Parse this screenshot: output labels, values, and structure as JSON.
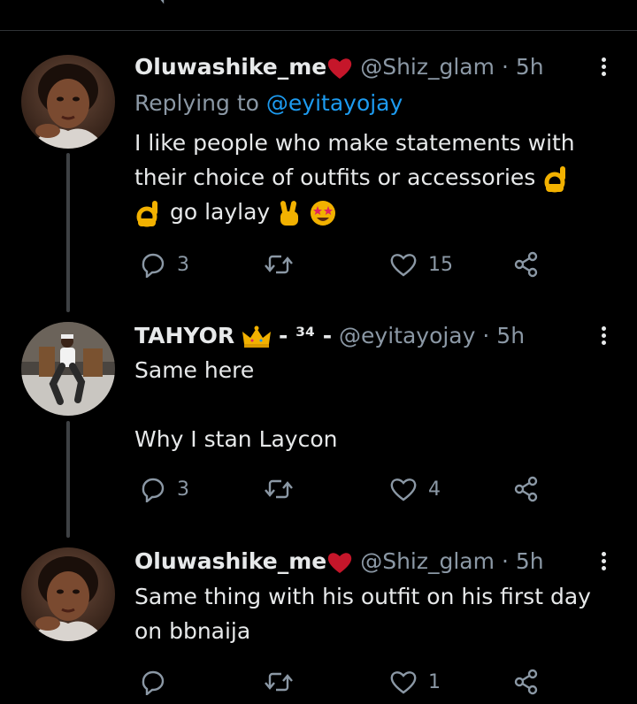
{
  "tweets": [
    {
      "name": "Oluwashike_me",
      "name_emoji": "red-heart",
      "handle": "@Shiz_glam",
      "time": "· 5h",
      "replying_prefix": "Replying to",
      "replying_to": "@eyitayojay",
      "text_lines": [
        "I like people who make statements with",
        "their choice of outfits or accessories",
        "go laylay"
      ],
      "emojis": [
        "ok-hand",
        "ok-hand",
        "victory-hand",
        "star-struck"
      ],
      "replies": "3",
      "retweets": "",
      "likes": "15"
    },
    {
      "name": "TAHYOR",
      "name_extra": "- ³⁴ -",
      "name_emoji": "crown",
      "handle": "@eyitayojay",
      "time": "· 5h",
      "text_lines": [
        "Same here",
        "",
        "Why I stan Laycon"
      ],
      "replies": "3",
      "retweets": "",
      "likes": "4"
    },
    {
      "name": "Oluwashike_me",
      "name_emoji": "red-heart",
      "handle": "@Shiz_glam",
      "time": "· 5h",
      "text_lines": [
        "Same thing with his outfit on his first day",
        "on bbnaija"
      ],
      "replies": "",
      "retweets": "",
      "likes": "1"
    }
  ],
  "colors": {
    "background": "#000000",
    "text": "#e7e9ea",
    "secondary": "#8b98a5",
    "link": "#1d9bf0",
    "divider": "#2f3336",
    "thread_line": "#3e4144"
  },
  "icons": [
    "reply-icon",
    "retweet-icon",
    "like-icon",
    "share-icon",
    "more-icon"
  ]
}
